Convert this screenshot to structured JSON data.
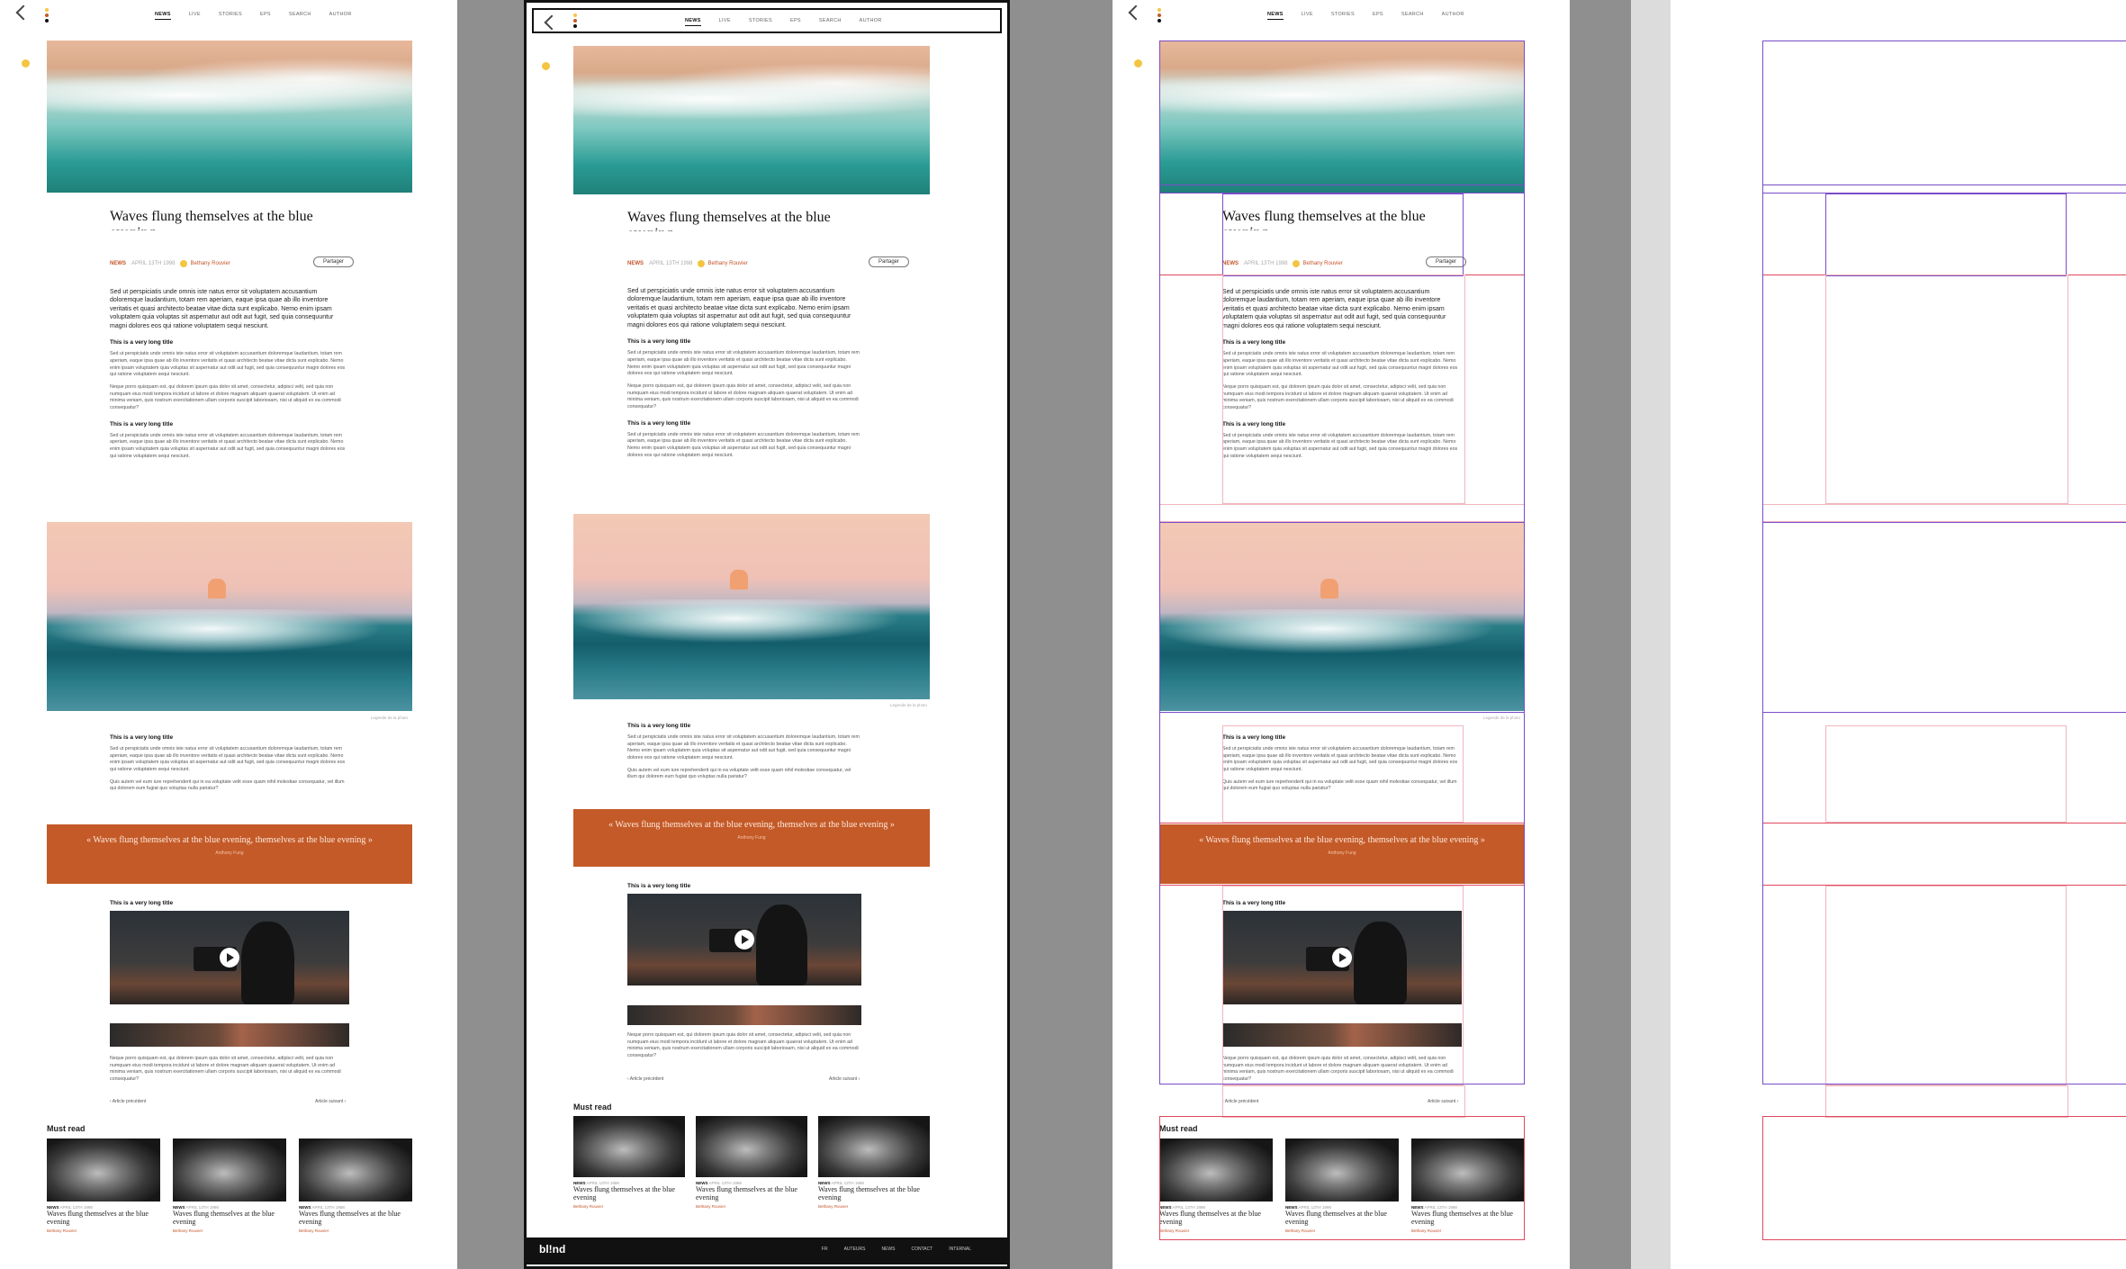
{
  "nav": {
    "links": [
      "NEWS",
      "LIVE",
      "STORIES",
      "EPS",
      "SEARCH",
      "AUTHOR"
    ]
  },
  "article": {
    "title": "Waves flung themselves at the blue evening",
    "tag": "NEWS",
    "date": "APRIL 13TH 1998",
    "author": "Bethany Rouvier",
    "share_label": "Partager",
    "lead": "Sed ut perspiciatis unde omnis iste natus error sit voluptatem accusantium doloremque laudantium, totam rem aperiam, eaque ipsa quae ab illo inventore veritatis et quasi architecto beatae vitae dicta sunt explicabo. Nemo enim ipsam voluptatem quia voluptas sit aspernatur aut odit aut fugit, sed quia consequuntur magni dolores eos qui ratione voluptatem sequi nesciunt.",
    "section_title": "This is a very long title",
    "para_a": "Sed ut perspiciatis unde omnis iste natus error sit voluptatem accusantium doloremque laudantium, totam rem aperiam, eaque ipsa quae ab illo inventore veritatis et quasi architecto beatae vitae dicta sunt explicabo. Nemo enim ipsam voluptatem quia voluptas sit aspernatur aut odit aut fugit, sed quia consequuntur magni dolores eos qui ratione voluptatem sequi nesciunt.",
    "para_b": "Neque porro quisquam est, qui dolorem ipsum quia dolor sit amet, consectetur, adipisci velit, sed quia non numquam eius modi tempora incidunt ut labore et dolore magnam aliquam quaerat voluptatem. Ut enim ad minima veniam, quis nostrum exercitationem ullam corporis suscipit laboriosam, nisi ut aliquid ex ea commodi consequatur?",
    "para_c": "Quis autem vel eum iure reprehenderit qui in ea voluptate velit esse quam nihil molestiae consequatur, vel illum qui dolorem eum fugiat quo voluptas nulla pariatur?",
    "caption": "Legende de la photo",
    "quote": "« Waves flung themselves at the blue evening, themselves at the blue evening »",
    "quote_author": "Anthony Fung",
    "prev": "‹ Article précédent",
    "next": "Article suivant ›"
  },
  "must_read": {
    "title": "Must read",
    "cards": [
      {
        "tag": "NEWS",
        "date": "APRIL 13TH 1998",
        "title": "Waves flung themselves at the blue evening",
        "author": "Bethany Rouvier"
      },
      {
        "tag": "NEWS",
        "date": "APRIL 13TH 1998",
        "title": "Waves flung themselves at the blue evening",
        "author": "Bethany Rouvier"
      },
      {
        "tag": "NEWS",
        "date": "APRIL 13TH 1998",
        "title": "Waves flung themselves at the blue evening",
        "author": "Bethany Rouvier"
      }
    ]
  },
  "footer": {
    "brand": "bl!nd",
    "links": [
      "FR",
      "AUTEURS",
      "NEWS",
      "CONTACT",
      "INTERNAL"
    ]
  },
  "colors": {
    "accent": "#c45a28",
    "highlight": "#f4c542",
    "overlay_purple": "#7b4cc9",
    "overlay_red": "#e0485c"
  }
}
